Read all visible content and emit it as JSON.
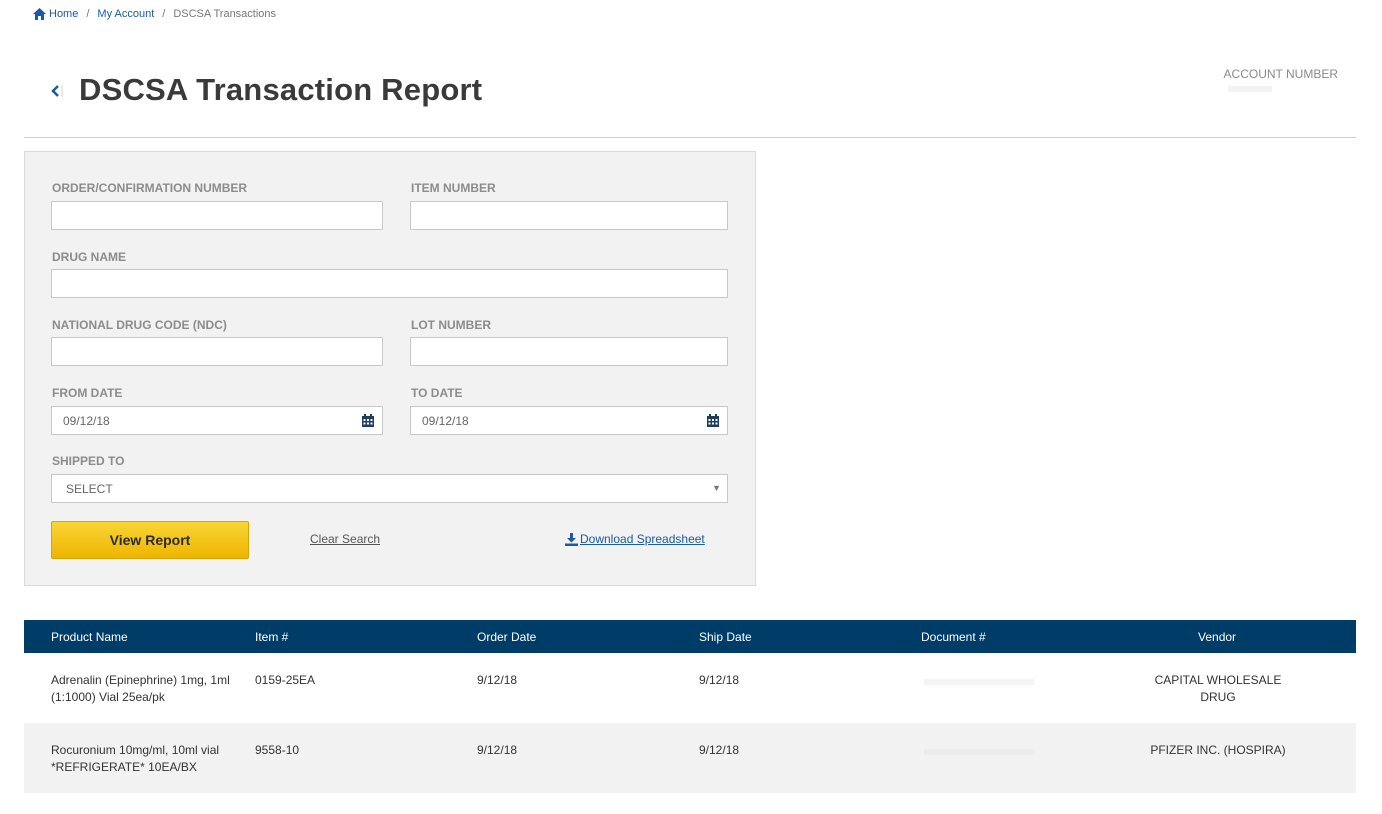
{
  "breadcrumb": {
    "home": "Home",
    "my_account": "My Account",
    "current": "DSCSA Transactions"
  },
  "header": {
    "title": "DSCSA Transaction Report",
    "account_label": "ACCOUNT NUMBER"
  },
  "search": {
    "order_label": "ORDER/CONFIRMATION NUMBER",
    "item_label": "ITEM NUMBER",
    "drug_label": "DRUG NAME",
    "ndc_label": "NATIONAL DRUG CODE (NDC)",
    "lot_label": "LOT NUMBER",
    "from_label": "FROM DATE",
    "from_value": "09/12/18",
    "to_label": "TO DATE",
    "to_value": "09/12/18",
    "shipped_label": "SHIPPED TO",
    "shipped_value": "SELECT",
    "view_report": "View Report",
    "clear_search": "Clear Search",
    "download": "Download Spreadsheet"
  },
  "table": {
    "headers": [
      "Product Name",
      "Item #",
      "Order Date",
      "Ship Date",
      "Document #",
      "Vendor"
    ],
    "rows": [
      {
        "product_line1": "Adrenalin (Epinephrine) 1mg, 1ml",
        "product_line2": "(1:1000) Vial 25ea/pk",
        "item": "0159-25EA",
        "order_date": "9/12/18",
        "ship_date": "9/12/18",
        "vendor_line1": "CAPITAL WHOLESALE",
        "vendor_line2": "DRUG"
      },
      {
        "product_line1": "Rocuronium 10mg/ml, 10ml vial",
        "product_line2": "*REFRIGERATE* 10EA/BX",
        "item": "9558-10",
        "order_date": "9/12/18",
        "ship_date": "9/12/18",
        "vendor_line1": "PFIZER INC. (HOSPIRA)",
        "vendor_line2": ""
      }
    ]
  },
  "colors": {
    "link": "#1a5aa6",
    "table_header": "#003c68",
    "button": "#f5c518"
  }
}
